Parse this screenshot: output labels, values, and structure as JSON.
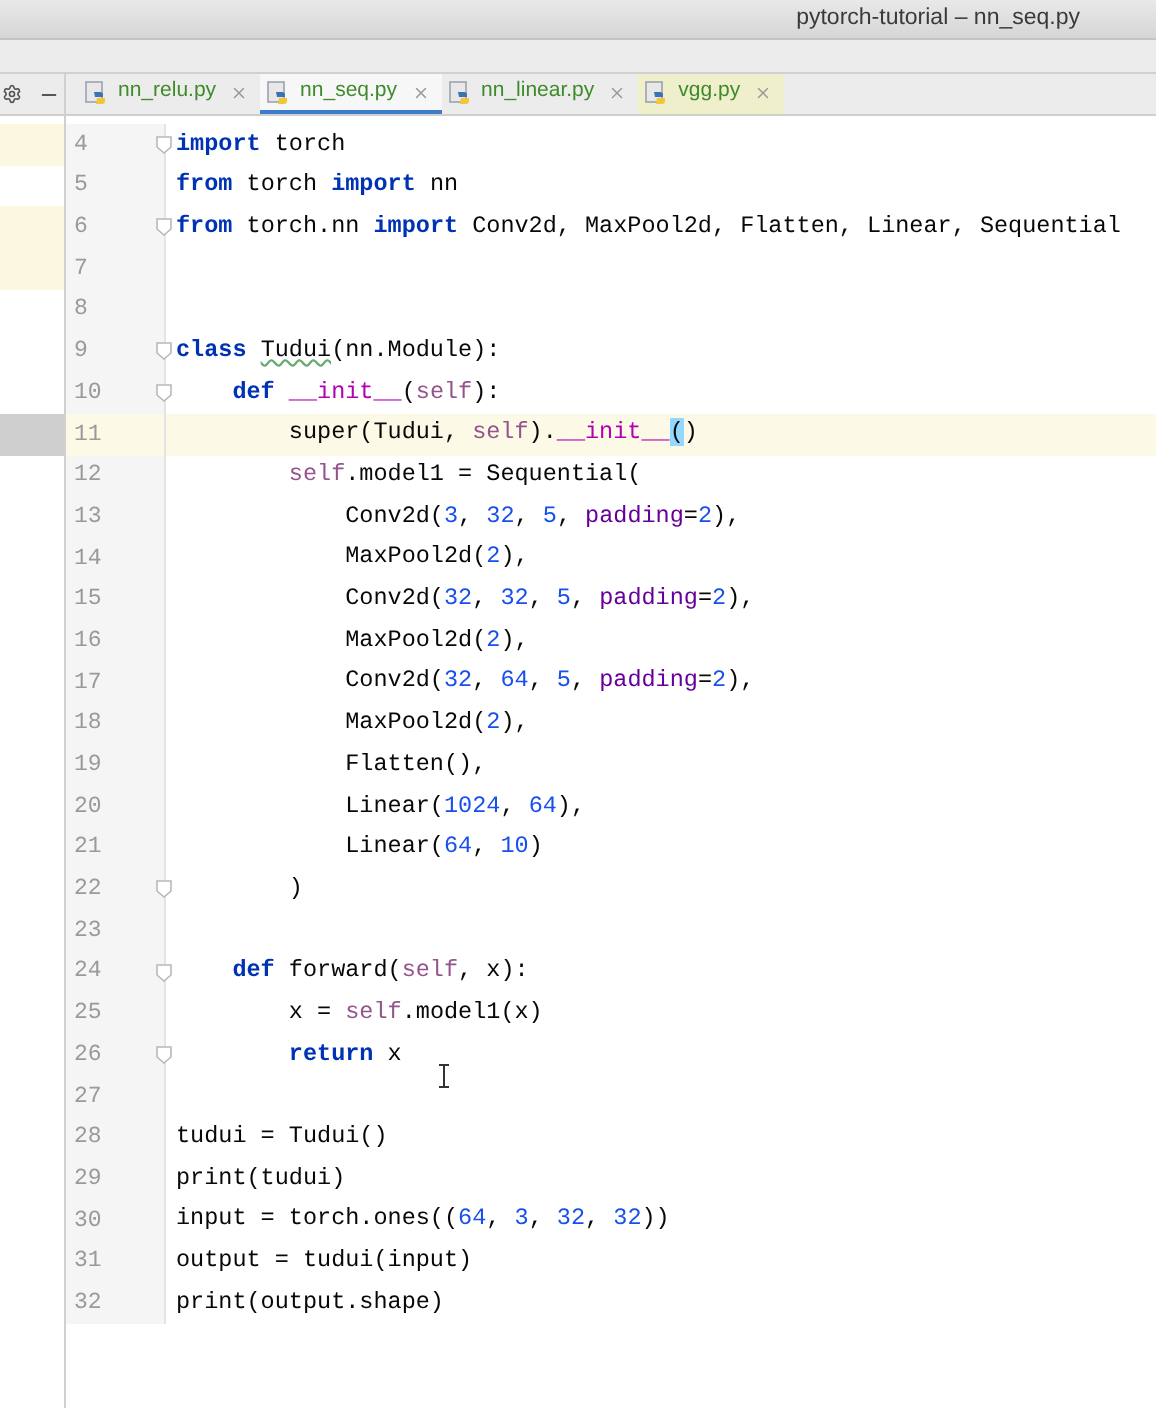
{
  "window": {
    "title": "pytorch-tutorial – nn_seq.py"
  },
  "tabs": [
    {
      "label": "nn_relu.py",
      "selected": false,
      "highlighted": false
    },
    {
      "label": "nn_seq.py",
      "selected": true,
      "highlighted": false
    },
    {
      "label": "nn_linear.py",
      "selected": false,
      "highlighted": false
    },
    {
      "label": "vgg.py",
      "selected": false,
      "highlighted": true
    }
  ],
  "project_rows": [
    {
      "kind": "modified"
    },
    {
      "kind": "plain"
    },
    {
      "kind": "modified"
    },
    {
      "kind": "modified"
    },
    {
      "kind": "plain"
    },
    {
      "kind": "plain"
    },
    {
      "kind": "plain"
    },
    {
      "kind": "selected"
    }
  ],
  "lines": [
    {
      "n": "4",
      "fold": true,
      "current": false,
      "tokens": [
        {
          "t": "import",
          "kind": "kw"
        },
        {
          "t": " torch",
          "kind": "plain"
        }
      ]
    },
    {
      "n": "5",
      "fold": false,
      "current": false,
      "tokens": [
        {
          "t": "from",
          "kind": "kw"
        },
        {
          "t": " torch ",
          "kind": "plain"
        },
        {
          "t": "import",
          "kind": "kw"
        },
        {
          "t": " nn",
          "kind": "plain"
        }
      ]
    },
    {
      "n": "6",
      "fold": true,
      "current": false,
      "tokens": [
        {
          "t": "from",
          "kind": "kw"
        },
        {
          "t": " torch.nn ",
          "kind": "plain"
        },
        {
          "t": "import",
          "kind": "kw"
        },
        {
          "t": " Conv2d, MaxPool2d, Flatten, Linear, Sequential",
          "kind": "plain"
        }
      ]
    },
    {
      "n": "7",
      "fold": false,
      "current": false
    },
    {
      "n": "8",
      "fold": false,
      "current": false
    },
    {
      "n": "9",
      "fold": true,
      "current": false,
      "tokens": [
        {
          "t": "class ",
          "kind": "kw"
        },
        {
          "t": "Tudui",
          "kind": "typo"
        },
        {
          "t": "(nn.Module):",
          "kind": "plain"
        }
      ]
    },
    {
      "n": "10",
      "fold": true,
      "current": false,
      "tokens": [
        {
          "t": "    def ",
          "kind": "kw"
        },
        {
          "t": "__init__",
          "kind": "magic"
        },
        {
          "t": "(",
          "kind": "plain"
        },
        {
          "t": "self",
          "kind": "self"
        },
        {
          "t": "):",
          "kind": "plain"
        }
      ]
    },
    {
      "n": "11",
      "fold": false,
      "current": true,
      "tokens": [
        {
          "t": "        super(Tudui, ",
          "kind": "plain"
        },
        {
          "t": "self",
          "kind": "self"
        },
        {
          "t": ").",
          "kind": "plain"
        },
        {
          "t": "__init__",
          "kind": "magic"
        },
        {
          "t": "(",
          "kind": "match"
        },
        {
          "t": ")",
          "kind": "plain"
        }
      ]
    },
    {
      "n": "12",
      "fold": false,
      "current": false,
      "tokens": [
        {
          "t": "        self",
          "kind": "self"
        },
        {
          "t": ".model1 = Sequential(",
          "kind": "plain"
        }
      ]
    },
    {
      "n": "13",
      "fold": false,
      "current": false,
      "tokens": [
        {
          "t": "            Conv2d(",
          "kind": "plain"
        },
        {
          "t": "3",
          "kind": "num"
        },
        {
          "t": ", ",
          "kind": "plain"
        },
        {
          "t": "32",
          "kind": "num"
        },
        {
          "t": ", ",
          "kind": "plain"
        },
        {
          "t": "5",
          "kind": "num"
        },
        {
          "t": ", ",
          "kind": "plain"
        },
        {
          "t": "padding",
          "kind": "param"
        },
        {
          "t": "=",
          "kind": "plain"
        },
        {
          "t": "2",
          "kind": "num"
        },
        {
          "t": "),",
          "kind": "plain"
        }
      ]
    },
    {
      "n": "14",
      "fold": false,
      "current": false,
      "tokens": [
        {
          "t": "            MaxPool2d(",
          "kind": "plain"
        },
        {
          "t": "2",
          "kind": "num"
        },
        {
          "t": "),",
          "kind": "plain"
        }
      ]
    },
    {
      "n": "15",
      "fold": false,
      "current": false,
      "tokens": [
        {
          "t": "            Conv2d(",
          "kind": "plain"
        },
        {
          "t": "32",
          "kind": "num"
        },
        {
          "t": ", ",
          "kind": "plain"
        },
        {
          "t": "32",
          "kind": "num"
        },
        {
          "t": ", ",
          "kind": "plain"
        },
        {
          "t": "5",
          "kind": "num"
        },
        {
          "t": ", ",
          "kind": "plain"
        },
        {
          "t": "padding",
          "kind": "param"
        },
        {
          "t": "=",
          "kind": "plain"
        },
        {
          "t": "2",
          "kind": "num"
        },
        {
          "t": "),",
          "kind": "plain"
        }
      ]
    },
    {
      "n": "16",
      "fold": false,
      "current": false,
      "tokens": [
        {
          "t": "            MaxPool2d(",
          "kind": "plain"
        },
        {
          "t": "2",
          "kind": "num"
        },
        {
          "t": "),",
          "kind": "plain"
        }
      ]
    },
    {
      "n": "17",
      "fold": false,
      "current": false,
      "tokens": [
        {
          "t": "            Conv2d(",
          "kind": "plain"
        },
        {
          "t": "32",
          "kind": "num"
        },
        {
          "t": ", ",
          "kind": "plain"
        },
        {
          "t": "64",
          "kind": "num"
        },
        {
          "t": ", ",
          "kind": "plain"
        },
        {
          "t": "5",
          "kind": "num"
        },
        {
          "t": ", ",
          "kind": "plain"
        },
        {
          "t": "padding",
          "kind": "param"
        },
        {
          "t": "=",
          "kind": "plain"
        },
        {
          "t": "2",
          "kind": "num"
        },
        {
          "t": "),",
          "kind": "plain"
        }
      ]
    },
    {
      "n": "18",
      "fold": false,
      "current": false,
      "tokens": [
        {
          "t": "            MaxPool2d(",
          "kind": "plain"
        },
        {
          "t": "2",
          "kind": "num"
        },
        {
          "t": "),",
          "kind": "plain"
        }
      ]
    },
    {
      "n": "19",
      "fold": false,
      "current": false,
      "tokens": [
        {
          "t": "            Flatten(),",
          "kind": "plain"
        }
      ]
    },
    {
      "n": "20",
      "fold": false,
      "current": false,
      "tokens": [
        {
          "t": "            Linear(",
          "kind": "plain"
        },
        {
          "t": "1024",
          "kind": "num"
        },
        {
          "t": ", ",
          "kind": "plain"
        },
        {
          "t": "64",
          "kind": "num"
        },
        {
          "t": "),",
          "kind": "plain"
        }
      ]
    },
    {
      "n": "21",
      "fold": false,
      "current": false,
      "tokens": [
        {
          "t": "            Linear(",
          "kind": "plain"
        },
        {
          "t": "64",
          "kind": "num"
        },
        {
          "t": ", ",
          "kind": "plain"
        },
        {
          "t": "10",
          "kind": "num"
        },
        {
          "t": ")",
          "kind": "plain"
        }
      ]
    },
    {
      "n": "22",
      "fold": true,
      "current": false,
      "tokens": [
        {
          "t": "        )",
          "kind": "plain"
        }
      ]
    },
    {
      "n": "23",
      "fold": false,
      "current": false
    },
    {
      "n": "24",
      "fold": true,
      "current": false,
      "tokens": [
        {
          "t": "    def",
          "kind": "kw"
        },
        {
          "t": " forward(",
          "kind": "plain"
        },
        {
          "t": "self",
          "kind": "self"
        },
        {
          "t": ", x):",
          "kind": "plain"
        }
      ]
    },
    {
      "n": "25",
      "fold": false,
      "current": false,
      "tokens": [
        {
          "t": "        x = ",
          "kind": "plain"
        },
        {
          "t": "self",
          "kind": "self"
        },
        {
          "t": ".model1(x)",
          "kind": "plain"
        }
      ]
    },
    {
      "n": "26",
      "fold": true,
      "current": false,
      "tokens": [
        {
          "t": "        return",
          "kind": "kw"
        },
        {
          "t": " x",
          "kind": "plain"
        }
      ]
    },
    {
      "n": "27",
      "fold": false,
      "current": false
    },
    {
      "n": "28",
      "fold": false,
      "current": false,
      "tokens": [
        {
          "t": "tudui = Tudui()",
          "kind": "plain"
        }
      ]
    },
    {
      "n": "29",
      "fold": false,
      "current": false,
      "tokens": [
        {
          "t": "print(tudui)",
          "kind": "plain"
        }
      ]
    },
    {
      "n": "30",
      "fold": false,
      "current": false,
      "tokens": [
        {
          "t": "input = torch.ones((",
          "kind": "plain"
        },
        {
          "t": "64",
          "kind": "num"
        },
        {
          "t": ", ",
          "kind": "plain"
        },
        {
          "t": "3",
          "kind": "num"
        },
        {
          "t": ", ",
          "kind": "plain"
        },
        {
          "t": "32",
          "kind": "num"
        },
        {
          "t": ", ",
          "kind": "plain"
        },
        {
          "t": "32",
          "kind": "num"
        },
        {
          "t": "))",
          "kind": "plain"
        }
      ]
    },
    {
      "n": "31",
      "fold": false,
      "current": false,
      "tokens": [
        {
          "t": "output = tudui(input)",
          "kind": "plain"
        }
      ]
    },
    {
      "n": "32",
      "fold": false,
      "current": false,
      "tokens": [
        {
          "t": "print(output.shape)",
          "kind": "plain"
        }
      ]
    }
  ]
}
